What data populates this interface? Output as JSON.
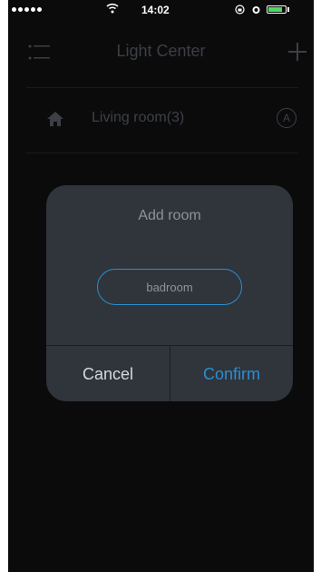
{
  "status_bar": {
    "time": "14:02",
    "battery_level": 0.85
  },
  "header": {
    "title": "Light Center",
    "menu_icon": "menu-icon",
    "add_icon": "plus-icon"
  },
  "rooms": [
    {
      "label": "Living room(3)",
      "icon": "home-icon",
      "badge": "A"
    }
  ],
  "dialog": {
    "title": "Add room",
    "input_value": "badroom",
    "cancel_label": "Cancel",
    "confirm_label": "Confirm"
  },
  "colors": {
    "accent": "#2a8fd0",
    "dialog_bg": "#30343b",
    "screen_bg": "#0b0b0c",
    "battery": "#4cd964"
  }
}
